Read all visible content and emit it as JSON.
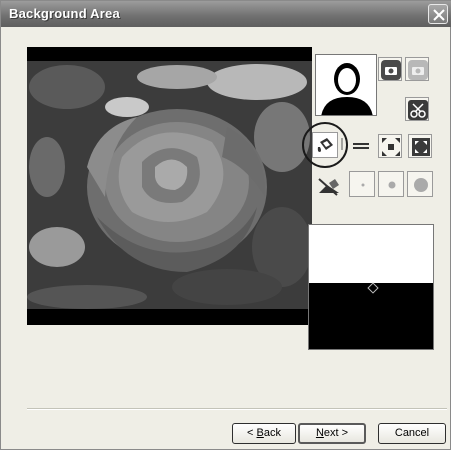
{
  "window": {
    "title": "Background Area"
  },
  "buttons": {
    "back_prefix": "< ",
    "back_mnemonic": "B",
    "back_rest": "ack",
    "next_mnemonic": "N",
    "next_rest": "ext >",
    "cancel": "Cancel"
  },
  "tools": {
    "portrait_icon": "portrait-silhouette-icon",
    "camera_add_icon": "camera-icon",
    "camera_remove_icon": "camera-disabled-icon",
    "clear_icon": "scissors-icon",
    "fill_icon": "paint-bucket-icon",
    "line_icon": "line-tool-icon",
    "expand_icon": "expand-icon",
    "shrink_icon": "shrink-icon",
    "erase_icon": "eraser-icon",
    "brush_small_icon": "dot-small-icon",
    "brush_medium_icon": "dot-medium-icon",
    "brush_large_icon": "dot-large-icon"
  },
  "colors": {
    "title_bar": "#7a7a7a",
    "dialog_bg": "#efeee6",
    "preview_bg": "#000000"
  }
}
